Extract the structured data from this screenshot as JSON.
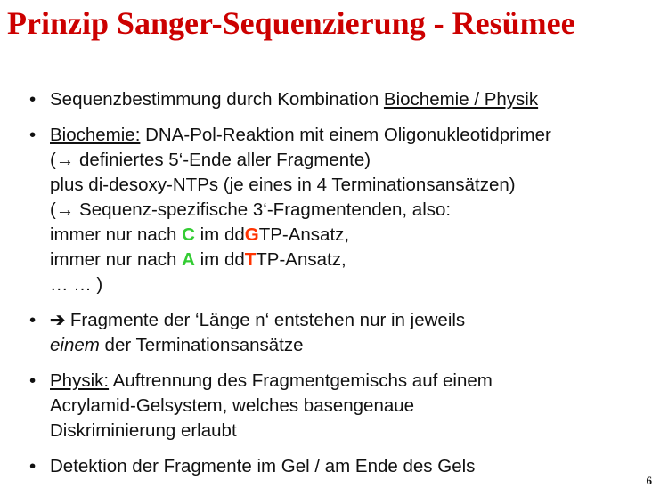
{
  "slide": {
    "title": "Prinzip Sanger-Sequenzierung - Resümee",
    "page_number": "6",
    "bullet_symbol": "•",
    "colors": {
      "title": "#cc0000",
      "green": "#33cc33",
      "orange": "#ff3300"
    },
    "bullet1": {
      "text": "Sequenzbestimmung durch Kombination ",
      "link": "Biochemie / Physik"
    },
    "bullet2": {
      "label": "Biochemie:",
      "line1": " DNA-Pol-Reaktion mit einem Oligonukleotidprimer",
      "line2_open": "(",
      "line2_arrow": "→",
      "line2_text": " definiertes 5‘-Ende aller Fragmente)",
      "line3": "plus di-desoxy-NTPs (je eines in 4 Terminationsansätzen)",
      "line4_open": "(",
      "line4_arrow": "→",
      "line4_text": " Sequenz-spezifische 3‘-Fragmentenden, also:",
      "line5_a": "immer nur nach ",
      "line5_c": "C",
      "line5_b": " im dd",
      "line5_g": "G",
      "line5_end": "TP-Ansatz,",
      "line6_a": "immer nur nach ",
      "line6_a2": "A",
      "line6_b": " im dd",
      "line6_t": "T",
      "line6_end": "TP-Ansatz,",
      "line7": "… … )"
    },
    "bullet3": {
      "arrow": "➔",
      "line1": " Fragmente der ‘Länge n‘ entstehen nur in jeweils",
      "line2_em": "einem",
      "line2_rest": "  der Terminationsansätze"
    },
    "bullet4": {
      "label": "Physik:",
      "line1": " Auftrennung des Fragmentgemischs auf einem",
      "line2": "Acrylamid-Gelsystem, welches basengenaue",
      "line3": "Diskriminierung erlaubt"
    },
    "bullet5": {
      "text": "Detektion der Fragmente im Gel / am Ende des Gels"
    }
  }
}
